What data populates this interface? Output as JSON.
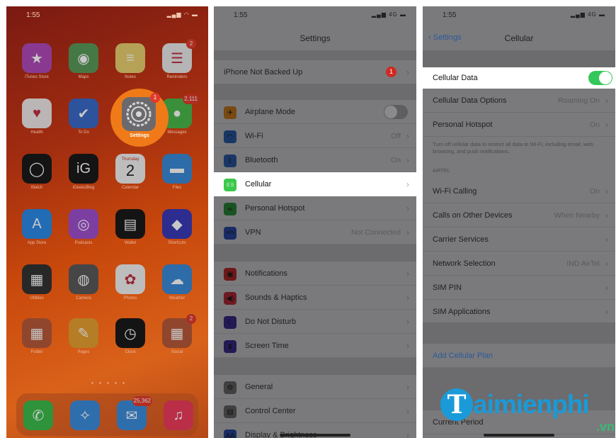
{
  "colors": {
    "accent_orange": "#f07a18",
    "ios_green": "#34c759",
    "ios_blue": "#2a5a9a",
    "badge_red": "#e03a2a",
    "watermark_blue": "#1a9ad8"
  },
  "home": {
    "time": "1:55",
    "apps": [
      {
        "label": "iTunes Store",
        "icon": "star-icon",
        "color": "#b04ab8"
      },
      {
        "label": "Maps",
        "icon": "map-icon",
        "color": "#5a9a5a"
      },
      {
        "label": "Notes",
        "icon": "notes-icon",
        "color": "#e8d070"
      },
      {
        "label": "Reminders",
        "icon": "reminders-icon",
        "color": "#e8e8e8",
        "badge": "2"
      },
      {
        "label": "Health",
        "icon": "heart-icon",
        "color": "#f0e8e8"
      },
      {
        "label": "To Do",
        "icon": "check-icon",
        "color": "#3a6ac8"
      },
      {
        "label": "Messages",
        "icon": "message-icon",
        "color": "#4ab84a",
        "badge": "2,111"
      },
      {
        "label": "Watch",
        "icon": "watch-icon",
        "color": "#1a1a1a"
      },
      {
        "label": "iGeeksBlog",
        "icon": "igb-icon",
        "color": "#1a1a1a"
      },
      {
        "label": "Calendar",
        "icon": "calendar-icon",
        "color": "#f2f2f2",
        "extra": "Thursday",
        "day": "2"
      },
      {
        "label": "Files",
        "icon": "folder-icon",
        "color": "#3a8ad8"
      },
      {
        "label": "App Store",
        "icon": "appstore-icon",
        "color": "#2a8ae8"
      },
      {
        "label": "Podcasts",
        "icon": "podcast-icon",
        "color": "#a050d0"
      },
      {
        "label": "Wallet",
        "icon": "wallet-icon",
        "color": "#1a1a1a"
      },
      {
        "label": "Shortcuts",
        "icon": "shortcuts-icon",
        "color": "#3a3ab8"
      },
      {
        "label": "Utilities",
        "icon": "calculator-icon",
        "color": "#333"
      },
      {
        "label": "Camera",
        "icon": "camera-icon",
        "color": "#5a5a5a"
      },
      {
        "label": "Photos",
        "icon": "photos-icon",
        "color": "#f2f2f2"
      },
      {
        "label": "Weather",
        "icon": "weather-icon",
        "color": "#3a8ad8"
      },
      {
        "label": "Folder",
        "icon": "folder-grid-icon",
        "color": "#b85a3a"
      },
      {
        "label": "Pages",
        "icon": "pages-icon",
        "color": "#e8a030"
      },
      {
        "label": "Clock",
        "icon": "clock-icon",
        "color": "#1a1a1a"
      },
      {
        "label": "Social",
        "icon": "social-grid-icon",
        "color": "#b85a3a",
        "badge": "2"
      }
    ],
    "settings": {
      "label": "Settings",
      "badge": "1"
    },
    "page_dots": "• • • • •",
    "dock": [
      {
        "icon": "phone-icon",
        "color": "#3ab84a"
      },
      {
        "icon": "safari-icon",
        "color": "#3a8ad8"
      },
      {
        "icon": "mail-icon",
        "color": "#3a8ad8",
        "badge": "25,362"
      },
      {
        "icon": "music-icon",
        "color": "#e83a5a"
      }
    ]
  },
  "settings_screen": {
    "time": "1:55",
    "signal": "4G",
    "title": "Settings",
    "backup": {
      "label": "iPhone Not Backed Up",
      "badge": "1"
    },
    "rows": [
      {
        "label": "Airplane Mode",
        "value": "",
        "icon": "airplane-icon",
        "color": "#c87a20",
        "toggle": true
      },
      {
        "label": "Wi-Fi",
        "value": "Off",
        "icon": "wifi-icon",
        "color": "#2a5aa8"
      },
      {
        "label": "Bluetooth",
        "value": "On",
        "icon": "bluetooth-icon",
        "color": "#2a5aa8"
      },
      {
        "label": "Cellular",
        "value": "",
        "icon": "cellular-icon",
        "color": "#3ac84a",
        "highlight": true
      },
      {
        "label": "Personal Hotspot",
        "value": "",
        "icon": "hotspot-icon",
        "color": "#2a8a3a"
      },
      {
        "label": "VPN",
        "value": "Not Connected",
        "icon": "vpn-icon",
        "color": "#2a4aa8"
      },
      {
        "label": "Notifications",
        "value": "",
        "icon": "notifications-icon",
        "color": "#b82a2a"
      },
      {
        "label": "Sounds & Haptics",
        "value": "",
        "icon": "sound-icon",
        "color": "#b82a3a"
      },
      {
        "label": "Do Not Disturb",
        "value": "",
        "icon": "moon-icon",
        "color": "#3a2a8a"
      },
      {
        "label": "Screen Time",
        "value": "",
        "icon": "hourglass-icon",
        "color": "#3a2a8a"
      },
      {
        "label": "General",
        "value": "",
        "icon": "gear-icon",
        "color": "#6a6a6a"
      },
      {
        "label": "Control Center",
        "value": "",
        "icon": "control-center-icon",
        "color": "#6a6a6a"
      },
      {
        "label": "Display & Brightness",
        "value": "",
        "icon": "display-icon",
        "color": "#2a4aa8"
      }
    ]
  },
  "cellular_screen": {
    "time": "1:55",
    "signal": "4G",
    "back": "Settings",
    "title": "Cellular",
    "data_row": {
      "label": "Cellular Data",
      "on": true
    },
    "rows1": [
      {
        "label": "Cellular Data Options",
        "value": "Roaming On"
      },
      {
        "label": "Personal Hotspot",
        "value": "On"
      }
    ],
    "note": "Turn off cellular data to restrict all data to Wi-Fi, including email, web browsing, and push notifications.",
    "section": "AIRTEL",
    "rows2": [
      {
        "label": "Wi-Fi Calling",
        "value": "On"
      },
      {
        "label": "Calls on Other Devices",
        "value": "When Nearby"
      },
      {
        "label": "Carrier Services",
        "value": ""
      },
      {
        "label": "Network Selection",
        "value": "IND AirTel"
      },
      {
        "label": "SIM PIN",
        "value": ""
      },
      {
        "label": "SIM Applications",
        "value": ""
      }
    ],
    "add_plan": "Add Cellular Plan",
    "bottom_row": "Current Period"
  },
  "watermark": {
    "letter": "T",
    "text": "aimienphi",
    "suffix": ".vn"
  }
}
